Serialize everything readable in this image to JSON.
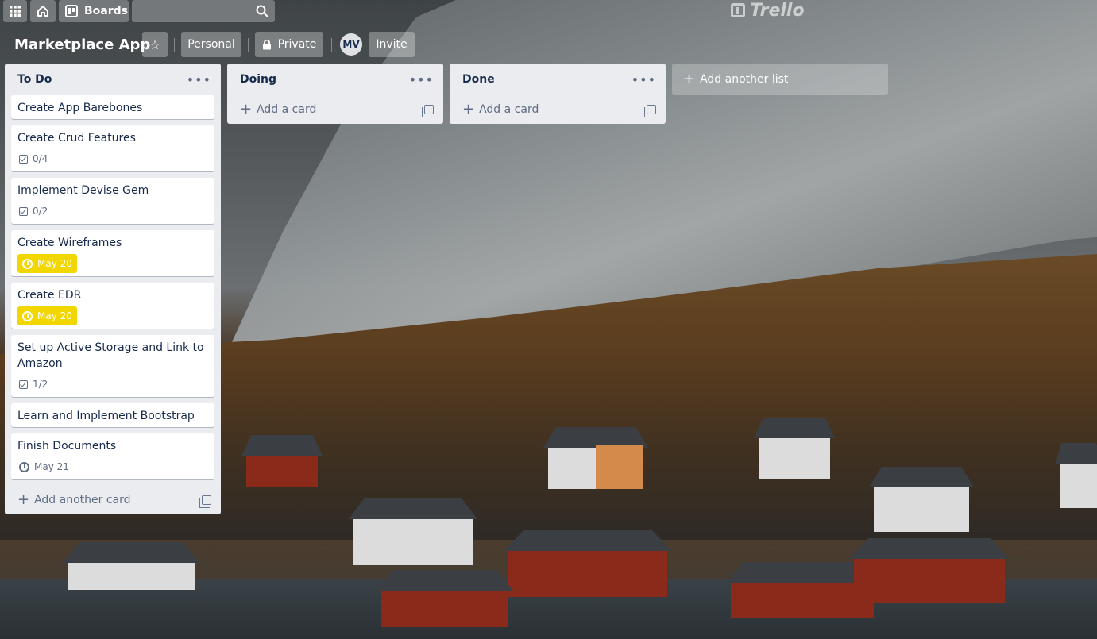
{
  "topbar": {
    "apps_icon": "grid-icon",
    "home_icon": "home-icon",
    "boards_label": "Boards",
    "search_placeholder": "",
    "logo_text": "Trello"
  },
  "board": {
    "title": "Marketplace App",
    "visibility_team": "Personal",
    "visibility_privacy": "Private",
    "member_initials": "MV",
    "invite_label": "Invite"
  },
  "lists": [
    {
      "title": "To Do",
      "cards": [
        {
          "title": "Create App Barebones"
        },
        {
          "title": "Create Crud Features",
          "checklist": "0/4"
        },
        {
          "title": "Implement Devise Gem",
          "checklist": "0/2"
        },
        {
          "title": "Create Wireframes",
          "due": "May 20",
          "due_status": "due-soon"
        },
        {
          "title": "Create EDR",
          "due": "May 20",
          "due_status": "due-soon"
        },
        {
          "title": "Set up Active Storage and Link to Amazon",
          "checklist": "1/2"
        },
        {
          "title": "Learn and Implement Bootstrap"
        },
        {
          "title": "Finish Documents",
          "due": "May 21",
          "due_status": "normal"
        }
      ],
      "add_card_label": "Add another card"
    },
    {
      "title": "Doing",
      "cards": [],
      "add_card_label": "Add a card"
    },
    {
      "title": "Done",
      "cards": [],
      "add_card_label": "Add a card"
    }
  ],
  "add_list_label": "Add another list",
  "colors": {
    "list_bg": "#ebecf0",
    "due_soon": "#f2d600",
    "text": "#172b4d",
    "muted": "#5e6c84"
  }
}
